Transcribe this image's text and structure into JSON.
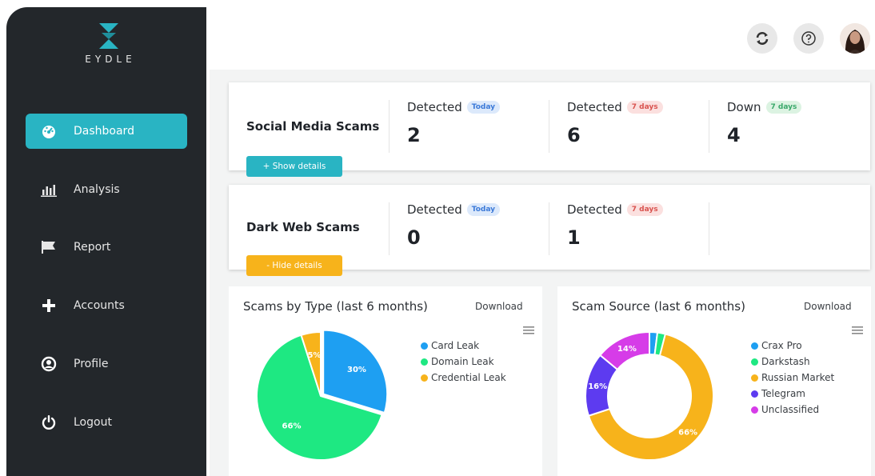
{
  "brand": {
    "name": "EYDLE",
    "accent": "#29b4c3"
  },
  "sidebar": {
    "items": [
      {
        "label": "Dashboard",
        "icon": "gauge-icon",
        "active": true
      },
      {
        "label": "Analysis",
        "icon": "bar-chart-icon"
      },
      {
        "label": "Report",
        "icon": "flag-icon"
      },
      {
        "label": "Accounts",
        "icon": "plus-icon"
      },
      {
        "label": "Profile",
        "icon": "user-circle-icon"
      },
      {
        "label": "Logout",
        "icon": "power-icon"
      }
    ]
  },
  "topbar": {
    "refresh_icon": "refresh-icon",
    "help_icon": "help-icon",
    "avatar": "user-avatar"
  },
  "social": {
    "title": "Social Media Scams",
    "stats": [
      {
        "label": "Detected",
        "badge": "Today",
        "value": "2"
      },
      {
        "label": "Detected",
        "badge": "7 days",
        "value": "6"
      },
      {
        "label": "Down",
        "badge": "7 days",
        "value": "4"
      }
    ],
    "action": "+ Show details"
  },
  "darkweb": {
    "title": "Dark Web Scams",
    "stats": [
      {
        "label": "Detected",
        "badge": "Today",
        "value": "0"
      },
      {
        "label": "Detected",
        "badge": "7 days",
        "value": "1"
      }
    ],
    "action": "- Hide details"
  },
  "chart_data": [
    {
      "type": "pie",
      "title": "Scams by Type (last 6 months)",
      "download": "Download",
      "categories": [
        "Card Leak",
        "Domain Leak",
        "Credential Leak"
      ],
      "values": [
        30,
        66,
        5
      ],
      "labels": [
        "30%",
        "66%",
        "5%"
      ],
      "colors": [
        "#1e9ff2",
        "#1ee882",
        "#f7b31b"
      ],
      "legend": "right"
    },
    {
      "type": "pie",
      "title": "Scam Source (last 6 months)",
      "download": "Download",
      "categories": [
        "Crax Pro",
        "Darkstash",
        "Russian Market",
        "Telegram",
        "Unclassified"
      ],
      "values": [
        2,
        2,
        66,
        16,
        14
      ],
      "labels": [
        "",
        "",
        "66%",
        "16%",
        "14%"
      ],
      "colors": [
        "#1e9ff2",
        "#1ee882",
        "#f7b31b",
        "#5d3bf0",
        "#d63ce8"
      ],
      "legend": "right"
    }
  ]
}
